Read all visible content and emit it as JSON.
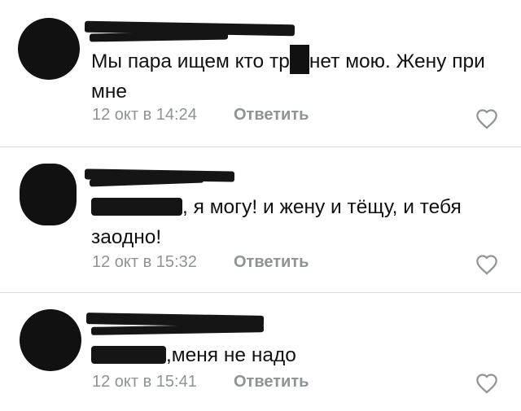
{
  "comments": [
    {
      "text_before": "Мы пара ищем кто тр",
      "text_after": "нет мою. Жену при мне",
      "time": "12 окт в 14:24",
      "reply": "Ответить",
      "like_icon": "heart-outline-icon"
    },
    {
      "text": ", я могу! и жену и тёщу, и тебя заодно!",
      "time": "12 окт в 15:32",
      "reply": "Ответить",
      "like_icon": "heart-outline-icon"
    },
    {
      "text": ",меня не надо",
      "time": "12 окт в 15:41",
      "reply": "Ответить",
      "like_icon": "heart-outline-icon"
    }
  ],
  "colors": {
    "text": "#111111",
    "meta": "#8e9398",
    "divider": "#d8dadd",
    "redaction": "#151515"
  }
}
